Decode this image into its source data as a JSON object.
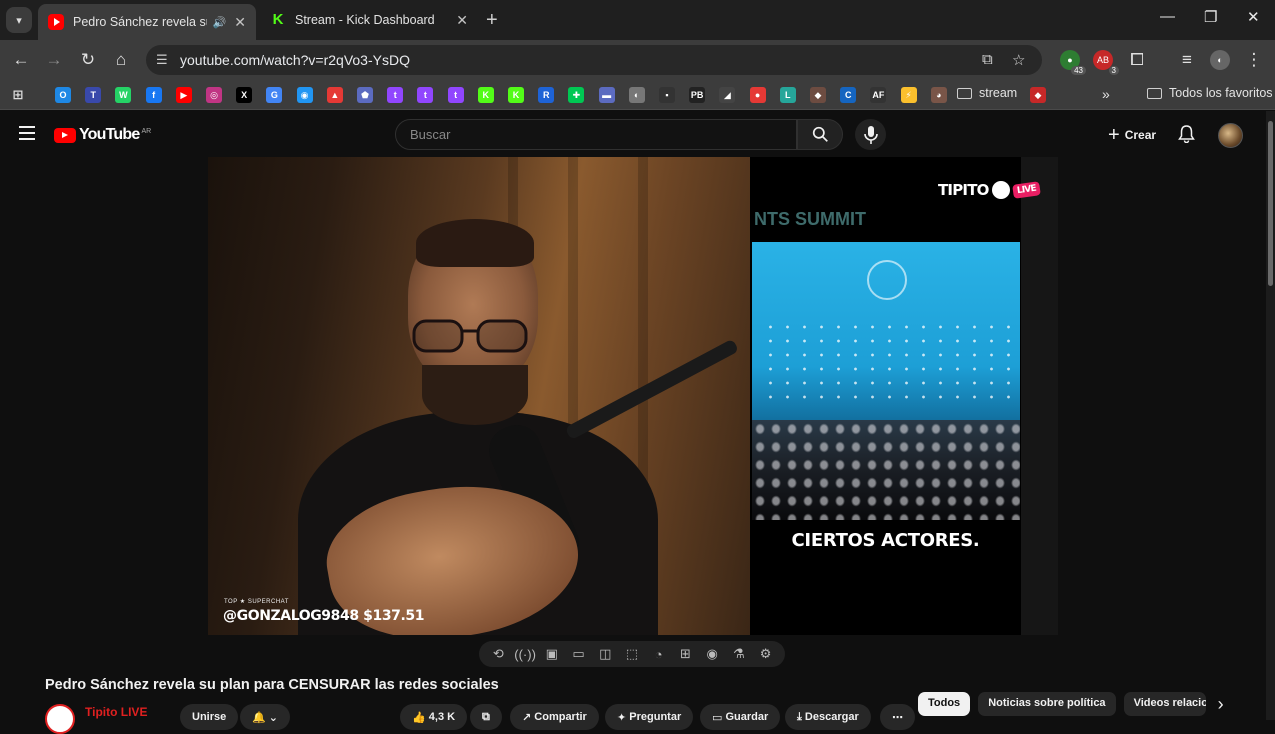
{
  "browser": {
    "tabs": [
      {
        "title": "Pedro Sánchez revela su pla",
        "active": true
      },
      {
        "title": "Stream - Kick Dashboard",
        "active": false
      }
    ],
    "new_tab": "+",
    "window_controls": {
      "minimize": "—",
      "restore": "❐",
      "close": "✕"
    },
    "url": "youtube.com/watch?v=r2qVo3-YsDQ",
    "extension_badges": [
      "43",
      "3"
    ],
    "bookmarks_folder": "stream",
    "all_bookmarks": "Todos los favoritos",
    "bookmark_icons": [
      "O",
      "T",
      "W",
      "f",
      "▶",
      "◎",
      "X",
      "G",
      "◉",
      "▲",
      "⬟",
      "t",
      "t",
      "t",
      "K",
      "K",
      "R",
      "✚",
      "▬",
      "◐",
      "▪",
      "PB",
      "◢",
      "●",
      "L",
      "◆",
      "C",
      "AF",
      "⚡",
      "◕"
    ]
  },
  "youtube": {
    "logo_text": "YouTube",
    "country_code": "AR",
    "search_placeholder": "Buscar",
    "create_label": "Crear",
    "video": {
      "superchat_label": "TOP ★ SUPERCHAT",
      "superchat_text": "@GONZALOG9848 $137.51",
      "clip_caption": "CIERTOS ACTORES.",
      "channel_brand": "TIPITO",
      "live_tag": "LIVE",
      "summit_banner": "NTS SUMMIT"
    },
    "title": "Pedro Sánchez revela su plan para CENSURAR las redes sociales",
    "channel_name": "Tipito LIVE",
    "actions": {
      "join": "Unirse",
      "likes": "4,3 K",
      "share": "Compartir",
      "ask": "Preguntar",
      "save": "Guardar",
      "download": "Descargar"
    },
    "chips": [
      "Todos",
      "Noticias sobre política",
      "Videos relacionados"
    ]
  },
  "colors": {
    "youtube_red": "#ff0000",
    "kick_green": "#53fc18",
    "chrome_dark": "#1f1f1f",
    "chrome_toolbar": "#3c3c3c",
    "yt_bg": "#0f0f0f",
    "live_pink": "#e91e63"
  }
}
